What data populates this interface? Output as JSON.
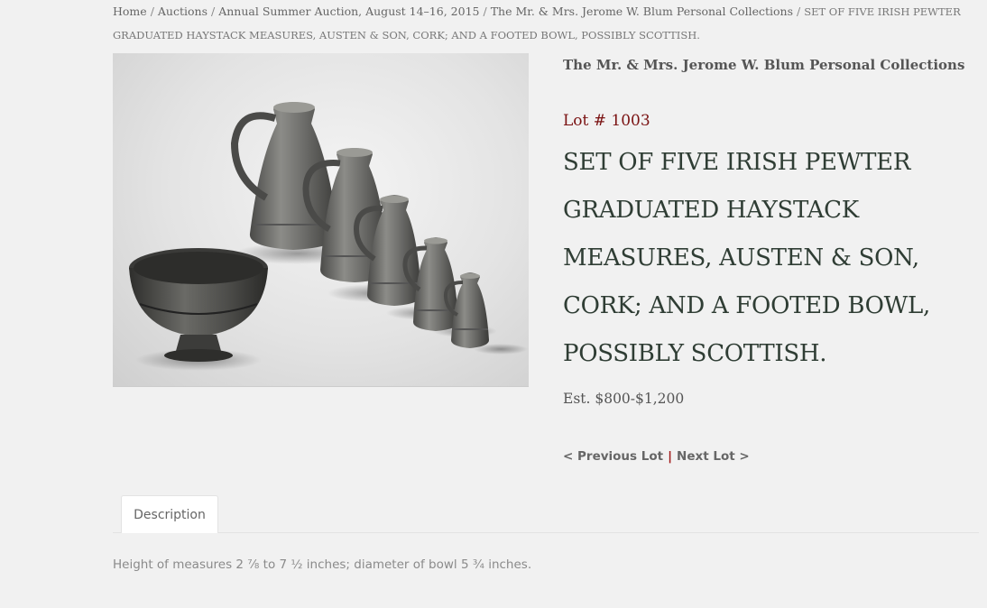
{
  "breadcrumb": {
    "items": [
      {
        "label": "Home"
      },
      {
        "label": "Auctions"
      },
      {
        "label": "Annual Summer Auction, August 14–16, 2015"
      },
      {
        "label": "The Mr. & Mrs. Jerome W. Blum Personal Collections"
      }
    ],
    "separator": "/",
    "current": "SET OF FIVE IRISH PEWTER GRADUATED HAYSTACK MEASURES, AUSTEN & SON, CORK; AND A FOOTED BOWL, POSSIBLY SCOTTISH."
  },
  "lot": {
    "collection": "The Mr. & Mrs. Jerome W. Blum Personal Collections",
    "number": "Lot # 1003",
    "title": "SET OF FIVE IRISH PEWTER GRADUATED HAYSTACK MEASURES, AUSTEN & SON, CORK; AND A FOOTED BOWL, POSSIBLY SCOTTISH.",
    "estimate": "Est. $800-$1,200"
  },
  "nav": {
    "previous": "< Previous Lot",
    "divider": "|",
    "next": "Next Lot >"
  },
  "tabs": [
    {
      "label": "Description",
      "active": true
    }
  ],
  "description": {
    "text": "Height of measures 2 ⅞ to 7 ½ inches; diameter of bowl 5 ¾ inches."
  },
  "colors": {
    "background": "#f1f1f1",
    "accent": "#7a1212",
    "title": "#2f3d34"
  }
}
